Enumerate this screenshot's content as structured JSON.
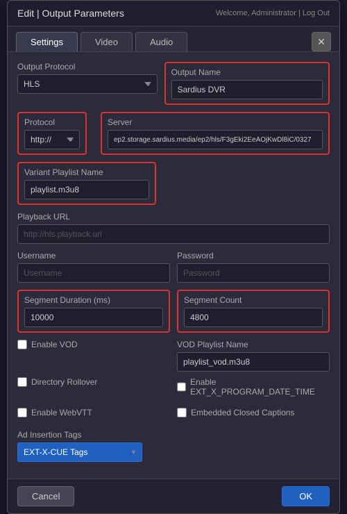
{
  "dialog": {
    "title": "Edit | Output Parameters",
    "topRightInfo": "Welcome, Administrator | Log Out"
  },
  "tabs": [
    {
      "label": "Settings",
      "active": true
    },
    {
      "label": "Video",
      "active": false
    },
    {
      "label": "Audio",
      "active": false
    }
  ],
  "close_button_label": "✕",
  "fields": {
    "output_protocol_label": "Output Protocol",
    "output_protocol_value": "HLS",
    "output_name_label": "Output Name",
    "output_name_value": "Sardius DVR",
    "protocol_label": "Protocol",
    "protocol_value": "http://",
    "server_label": "Server",
    "server_value": "ep2.storage.sardius.media/ep2/hls/F3gEki2EeAOjKwDl8iC/0327",
    "variant_playlist_label": "Variant Playlist Name",
    "variant_playlist_value": "playlist.m3u8",
    "playback_url_label": "Playback URL",
    "playback_url_placeholder": "http://hls.playback.url",
    "username_label": "Username",
    "username_placeholder": "Username",
    "password_label": "Password",
    "password_placeholder": "Password",
    "segment_duration_label": "Segment Duration (ms)",
    "segment_duration_value": "10000",
    "segment_count_label": "Segment Count",
    "segment_count_value": "4800",
    "enable_vod_label": "Enable VOD",
    "vod_playlist_name_label": "VOD Playlist Name",
    "vod_playlist_name_value": "playlist_vod.m3u8",
    "directory_rollover_label": "Directory Rollover",
    "enable_ext_label": "Enable EXT_X_PROGRAM_DATE_TIME",
    "enable_webvtt_label": "Enable WebVTT",
    "embedded_closed_captions_label": "Embedded Closed Captions",
    "ad_insertion_tags_label": "Ad Insertion Tags",
    "ad_insertion_tags_value": "EXT-X-CUE Tags"
  },
  "footer": {
    "cancel_label": "Cancel",
    "ok_label": "OK"
  }
}
